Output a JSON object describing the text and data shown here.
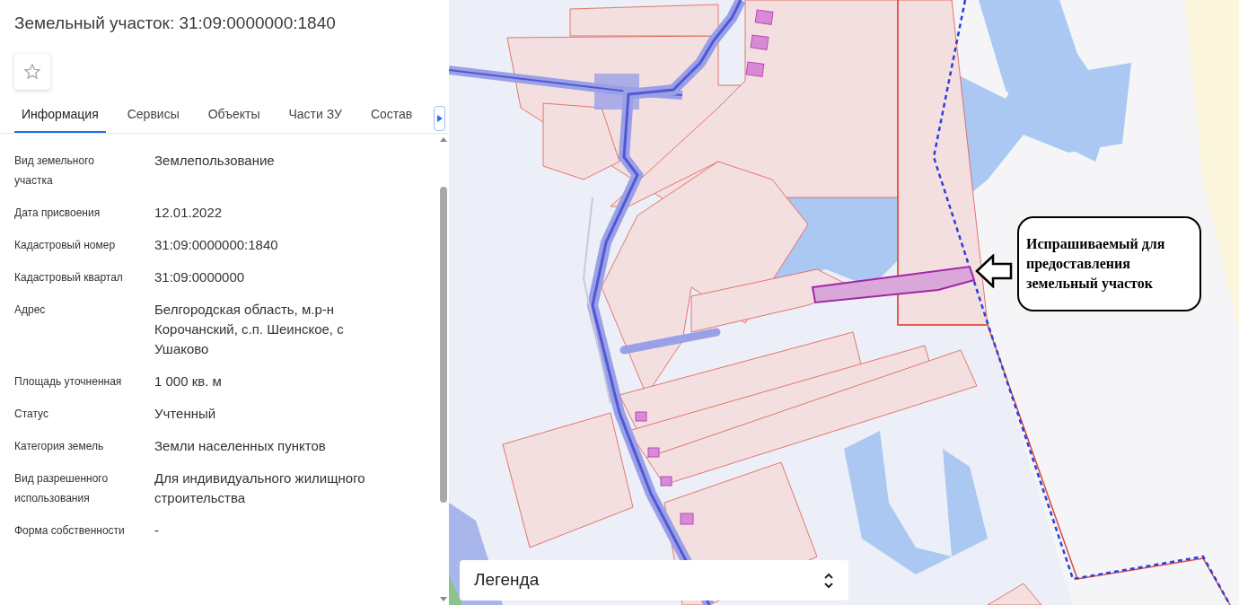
{
  "panel": {
    "title": "Земельный участок: 31:09:0000000:1840",
    "favorite": false
  },
  "tabs": [
    {
      "label": "Информация",
      "selected": true
    },
    {
      "label": "Сервисы",
      "selected": false
    },
    {
      "label": "Объекты",
      "selected": false
    },
    {
      "label": "Части ЗУ",
      "selected": false
    },
    {
      "label": "Состав",
      "selected": false
    }
  ],
  "fields": [
    {
      "label": "Вид земельного участка",
      "value": "Землепользование"
    },
    {
      "label": "Дата присвоения",
      "value": "12.01.2022"
    },
    {
      "label": "Кадастровый номер",
      "value": "31:09:0000000:1840"
    },
    {
      "label": "Кадастровый квартал",
      "value": "31:09:0000000"
    },
    {
      "label": "Адрес",
      "value": "Белгородская область, м.р-н Корочанский, с.п. Шеинское, с Ушаково"
    },
    {
      "label": "Площадь уточненная",
      "value": "1 000 кв. м"
    },
    {
      "label": "Статус",
      "value": "Учтенный"
    },
    {
      "label": "Категория земель",
      "value": "Земли населенных пунктов"
    },
    {
      "label": "Вид разрешенного использования",
      "value": "Для индивидуального жилищного строительства"
    },
    {
      "label": "Форма собственности",
      "value": "-"
    }
  ],
  "map": {
    "callout": "Испрашиваемый для предоставления земельный участок",
    "legend": {
      "label": "Легенда",
      "expanded": false
    }
  }
}
